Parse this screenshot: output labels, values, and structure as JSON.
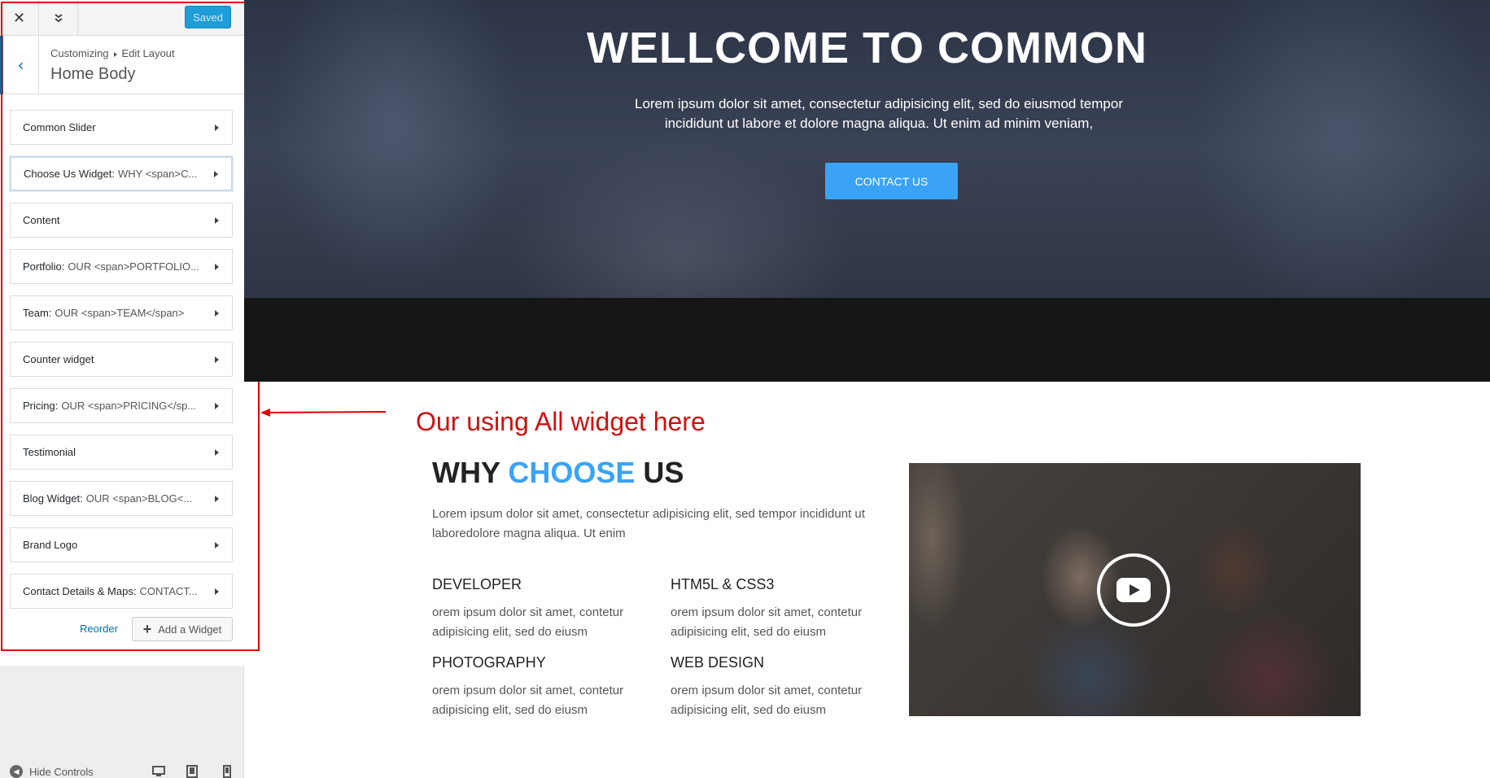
{
  "toolbar": {
    "close_icon": "close-icon",
    "collapse_icon": "collapse-icon",
    "saved_label": "Saved"
  },
  "panel": {
    "breadcrumb_root": "Customizing",
    "breadcrumb_current": "Edit Layout",
    "title": "Home Body"
  },
  "widgets": [
    {
      "label": "Common Slider",
      "sub": ""
    },
    {
      "label": "Choose Us Widget:",
      "sub": "WHY <span>C..."
    },
    {
      "label": "Content",
      "sub": ""
    },
    {
      "label": "Portfolio:",
      "sub": "OUR <span>PORTFOLIO..."
    },
    {
      "label": "Team:",
      "sub": "OUR <span>TEAM</span>"
    },
    {
      "label": "Counter widget",
      "sub": ""
    },
    {
      "label": "Pricing:",
      "sub": "OUR <span>PRICING</sp..."
    },
    {
      "label": "Testimonial",
      "sub": ""
    },
    {
      "label": "Blog Widget:",
      "sub": "OUR <span>BLOG<..."
    },
    {
      "label": "Brand Logo",
      "sub": ""
    },
    {
      "label": "Contact Details & Maps:",
      "sub": "CONTACT..."
    }
  ],
  "actions": {
    "reorder": "Reorder",
    "add_widget": "Add a Widget"
  },
  "footer": {
    "hide_controls": "Hide Controls",
    "devices": [
      "desktop-icon",
      "tablet-icon",
      "mobile-icon"
    ]
  },
  "annotation": {
    "text": "Our using All widget here",
    "color": "#e00000"
  },
  "hero": {
    "title": "WELLCOME TO COMMON",
    "subtitle": "Lorem ipsum dolor sit amet, consectetur adipisicing elit, sed do eiusmod tempor incididunt ut labore et dolore magna aliqua. Ut enim ad minim veniam,",
    "button": "CONTACT US"
  },
  "why": {
    "title_a": "WHY",
    "title_accent": "CHOOSE",
    "title_b": "US",
    "description": "Lorem ipsum dolor sit amet, consectetur adipisicing elit, sed tempor incididunt ut laboredolore magna aliqua. Ut enim",
    "features": [
      {
        "title": "DEVELOPER",
        "text": "orem ipsum dolor sit amet, contetur adipisicing elit, sed do eiusm"
      },
      {
        "title": "HTM5L & CSS3",
        "text": "orem ipsum dolor sit amet, contetur adipisicing elit, sed do eiusm"
      },
      {
        "title": "PHOTOGRAPHY",
        "text": "orem ipsum dolor sit amet, contetur adipisicing elit, sed do eiusm"
      },
      {
        "title": "WEB DESIGN",
        "text": "orem ipsum dolor sit amet, contetur adipisicing elit, sed do eiusm"
      }
    ]
  },
  "colors": {
    "accent": "#3aa3f5",
    "wp_blue": "#0073aa",
    "saved_button": "#1e9dd8"
  }
}
